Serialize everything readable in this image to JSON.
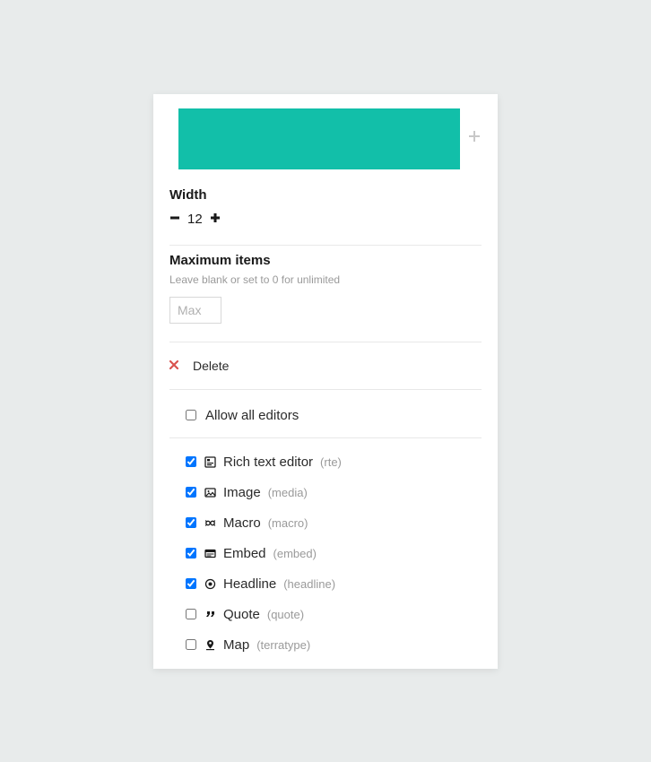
{
  "width": {
    "label": "Width",
    "value": "12"
  },
  "maxItems": {
    "label": "Maximum items",
    "help": "Leave blank or set to 0 for unlimited",
    "placeholder": "Max"
  },
  "delete": {
    "label": "Delete"
  },
  "allowAll": {
    "label": "Allow all editors",
    "checked": false
  },
  "editors": [
    {
      "name": "Rich text editor",
      "alias": "(rte)",
      "icon": "rte",
      "checked": true
    },
    {
      "name": "Image",
      "alias": "(media)",
      "icon": "image",
      "checked": true
    },
    {
      "name": "Macro",
      "alias": "(macro)",
      "icon": "macro",
      "checked": true
    },
    {
      "name": "Embed",
      "alias": "(embed)",
      "icon": "embed",
      "checked": true
    },
    {
      "name": "Headline",
      "alias": "(headline)",
      "icon": "headline",
      "checked": true
    },
    {
      "name": "Quote",
      "alias": "(quote)",
      "icon": "quote",
      "checked": false
    },
    {
      "name": "Map",
      "alias": "(terratype)",
      "icon": "map",
      "checked": false
    }
  ]
}
